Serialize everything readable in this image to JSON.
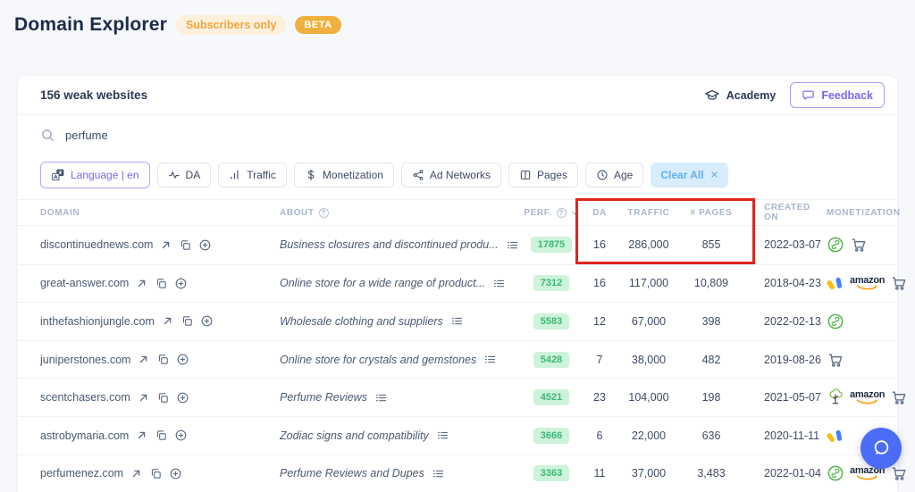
{
  "header": {
    "title": "Domain Explorer",
    "subscribers_badge": "Subscribers only",
    "beta_badge": "BETA"
  },
  "panel": {
    "count": "156 weak websites",
    "academy": "Academy",
    "feedback": "Feedback"
  },
  "search": {
    "value": "perfume"
  },
  "filters": {
    "language": "Language | en",
    "da": "DA",
    "traffic": "Traffic",
    "monetization": "Monetization",
    "ad_networks": "Ad Networks",
    "pages": "Pages",
    "age": "Age",
    "clear_all": "Clear All"
  },
  "table": {
    "headers": [
      "DOMAIN",
      "ABOUT",
      "PERF.",
      "DA",
      "TRAFFIC",
      "# PAGES",
      "CREATED ON",
      "MONETIZATION"
    ],
    "rows": [
      {
        "domain": "discontinuednews.com",
        "about": "Business closures and discontinued produ...",
        "perf": "17875",
        "da": "16",
        "traffic": "286,000",
        "pages": "855",
        "created": "2022-03-07",
        "monetization": [
          "affiliate-link",
          "cart"
        ]
      },
      {
        "domain": "great-answer.com",
        "about": "Online store for a wide range of product...",
        "perf": "7312",
        "da": "16",
        "traffic": "117,000",
        "pages": "10,809",
        "created": "2018-04-23",
        "monetization": [
          "adsense",
          "amazon",
          "cart"
        ]
      },
      {
        "domain": "inthefashionjungle.com",
        "about": "Wholesale clothing and suppliers",
        "perf": "5583",
        "da": "12",
        "traffic": "67,000",
        "pages": "398",
        "created": "2022-02-13",
        "monetization": [
          "affiliate-link"
        ]
      },
      {
        "domain": "juniperstones.com",
        "about": "Online store for crystals and gemstones",
        "perf": "5428",
        "da": "7",
        "traffic": "38,000",
        "pages": "482",
        "created": "2019-08-26",
        "monetization": [
          "cart"
        ]
      },
      {
        "domain": "scentchasers.com",
        "about": "Perfume Reviews",
        "perf": "4521",
        "da": "23",
        "traffic": "104,000",
        "pages": "198",
        "created": "2021-05-07",
        "monetization": [
          "tree",
          "amazon",
          "cart"
        ]
      },
      {
        "domain": "astrobymaria.com",
        "about": "Zodiac signs and compatibility",
        "perf": "3666",
        "da": "6",
        "traffic": "22,000",
        "pages": "636",
        "created": "2020-11-11",
        "monetization": [
          "adsense"
        ]
      },
      {
        "domain": "perfumenez.com",
        "about": "Perfume Reviews and Dupes",
        "perf": "3363",
        "da": "11",
        "traffic": "37,000",
        "pages": "3,483",
        "created": "2022-01-04",
        "monetization": [
          "affiliate-link",
          "amazon",
          "cart"
        ]
      }
    ]
  },
  "colors": {
    "accent_purple": "#7668ee",
    "perf_badge_bg": "#cdf3da",
    "perf_badge_text": "#3eb874",
    "highlight_red": "#e0251c",
    "chat_blue": "#4a6cf7",
    "beta_amber": "#f0b03f",
    "subscribers_orange": "#f0a43c",
    "clear_all_bg": "#d9ecfb",
    "clear_all_text": "#5fb0ed"
  }
}
